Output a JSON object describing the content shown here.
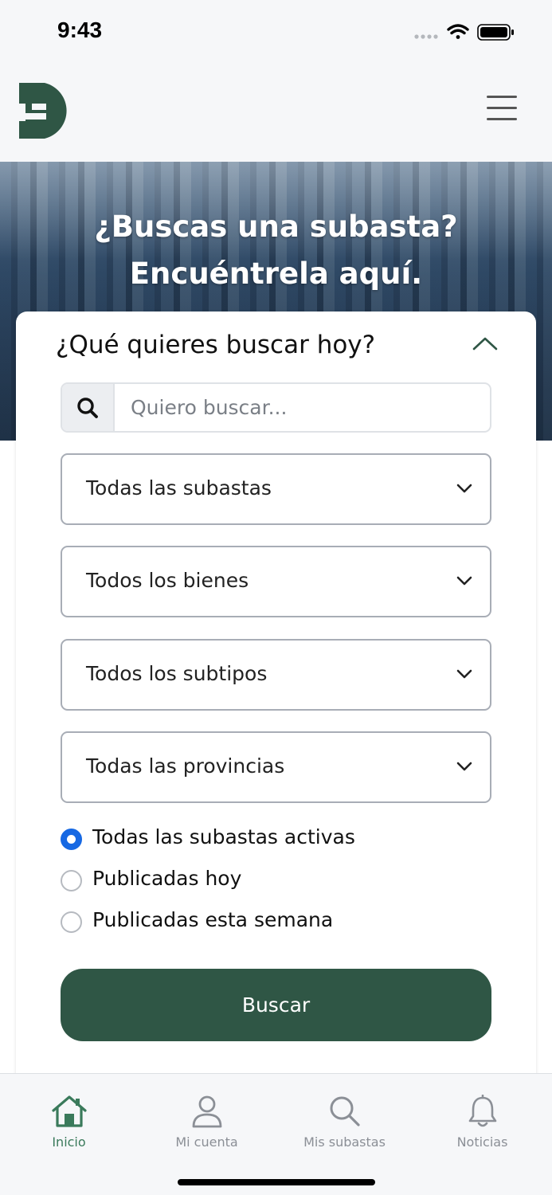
{
  "status_bar": {
    "time": "9:43"
  },
  "header": {
    "logo_icon": "brand-d-logo",
    "menu_icon": "hamburger-menu-icon"
  },
  "hero": {
    "title_line1": "¿Buscas una subasta?",
    "title_line2": "Encuéntrela aquí."
  },
  "search_card": {
    "title": "¿Qué quieres buscar hoy?",
    "collapse_icon": "chevron-up-icon",
    "search": {
      "placeholder": "Quiero buscar...",
      "value": "",
      "icon": "search-icon"
    },
    "selects": [
      {
        "label": "Todas las subastas"
      },
      {
        "label": "Todos los bienes"
      },
      {
        "label": "Todos los subtipos"
      },
      {
        "label": "Todas las provincias"
      }
    ],
    "radios": [
      {
        "label": "Todas las subastas activas",
        "checked": true
      },
      {
        "label": "Publicadas hoy",
        "checked": false
      },
      {
        "label": "Publicadas esta semana",
        "checked": false
      }
    ],
    "submit_label": "Buscar"
  },
  "bottom_nav": {
    "items": [
      {
        "label": "Inicio",
        "icon": "home-icon",
        "active": true
      },
      {
        "label": "Mi cuenta",
        "icon": "user-icon",
        "active": false
      },
      {
        "label": "Mis subastas",
        "icon": "search-icon",
        "active": false
      },
      {
        "label": "Noticias",
        "icon": "bell-icon",
        "active": false
      }
    ]
  },
  "colors": {
    "brand_green": "#2f5645",
    "active_nav": "#3a7a5b",
    "radio_selected": "#1668e3"
  }
}
